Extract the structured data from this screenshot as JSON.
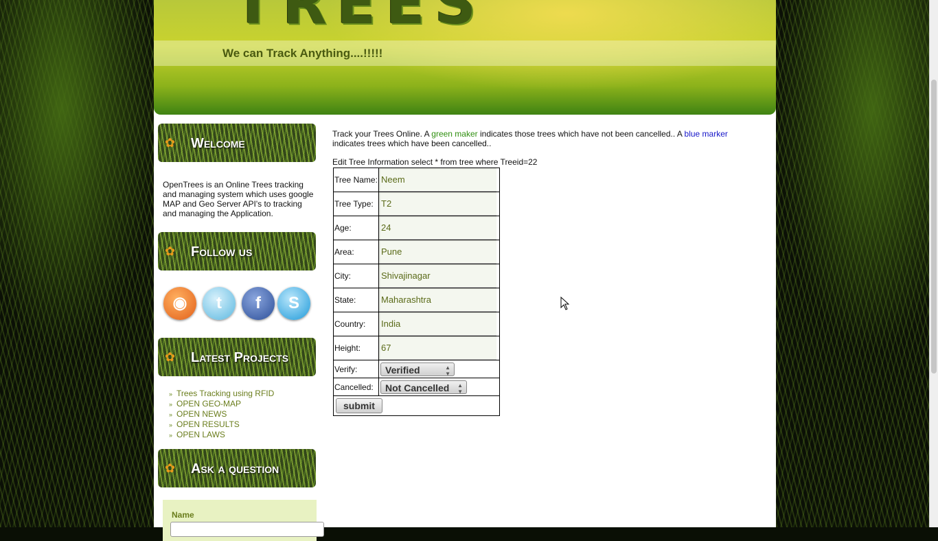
{
  "header": {
    "logo_text": "TREES",
    "tagline": "We can Track Anything....!!!!!"
  },
  "sidebar": {
    "welcome_title": "Welcome",
    "welcome_text": "OpenTrees is an Online Trees tracking and managing system which uses google MAP and Geo Server API's to tracking and managing the Application.",
    "follow_title": "Follow us",
    "social": [
      "rss-icon",
      "twitter-icon",
      "facebook-icon",
      "skype-icon"
    ],
    "projects_title": "Latest Projects",
    "projects": [
      "Trees Tracking using RFID",
      "OPEN GEO-MAP",
      "OPEN NEWS",
      "OPEN RESULTS",
      "OPEN LAWS"
    ],
    "ask_title": "Ask a question",
    "ask_name_label": "Name"
  },
  "main": {
    "intro_1": "Track your Trees Online. A ",
    "green_marker": "green maker",
    "intro_2": " indicates those trees which have not been cancelled.. A ",
    "blue_marker": "blue marker",
    "intro_3": " indicates trees which have been cancelled..",
    "edit_line": "Edit Tree Information select * from tree where Treeid=22",
    "fields": {
      "tree_name": {
        "label": "Tree Name:",
        "value": "Neem"
      },
      "tree_type": {
        "label": "Tree Type:",
        "value": "T2"
      },
      "age": {
        "label": "Age:",
        "value": "24"
      },
      "area": {
        "label": "Area:",
        "value": "Pune"
      },
      "city": {
        "label": "City:",
        "value": "Shivajinagar"
      },
      "state": {
        "label": "State:",
        "value": "Maharashtra"
      },
      "country": {
        "label": "Country:",
        "value": "India"
      },
      "height": {
        "label": "Height:",
        "value": "67"
      }
    },
    "verify": {
      "label": "Verify:",
      "value": "Verified"
    },
    "cancelled": {
      "label": "Cancelled:",
      "value": "Not Cancelled"
    },
    "submit_label": "submit"
  },
  "colors": {
    "accent_green": "#2f8f0f",
    "marker_blue": "#1414c8",
    "link_olive": "#6a7d1c"
  }
}
